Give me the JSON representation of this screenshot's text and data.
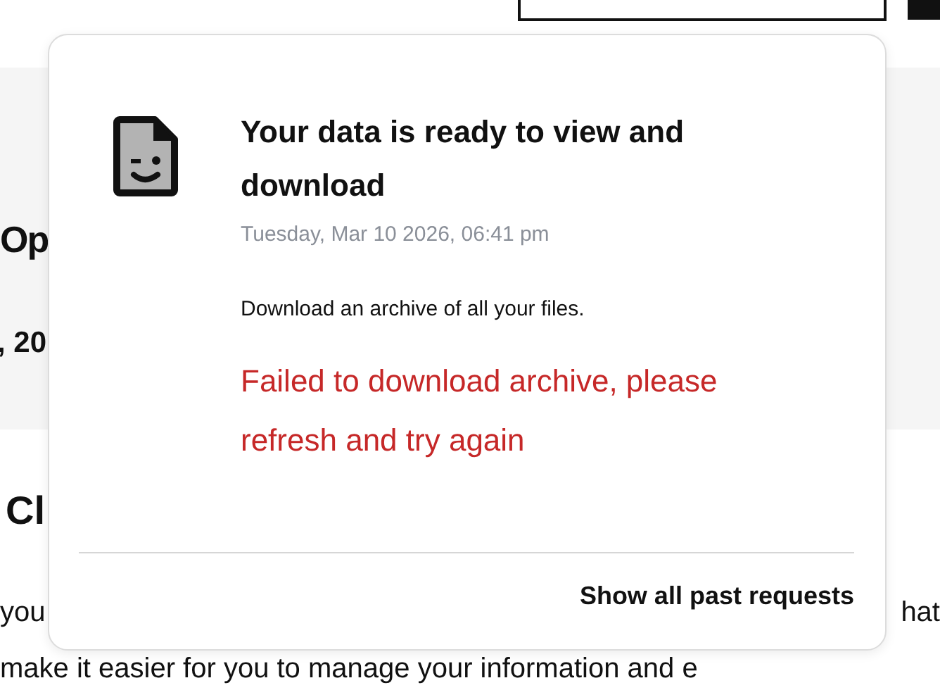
{
  "page": {
    "heading": "Op",
    "subheading": ", 20",
    "section_heading": "Cl",
    "paragraph_left": "you",
    "paragraph_right": "hat",
    "paragraph_line": "make it easier for you to manage your information and e"
  },
  "popover": {
    "title": "Your data is ready to view and download",
    "timestamp": "Tuesday, Mar 10 2026, 06:41 pm",
    "description": "Download an archive of all your files.",
    "error": "Failed to download archive, please refresh and try again",
    "footer_link": "Show all past requests"
  }
}
